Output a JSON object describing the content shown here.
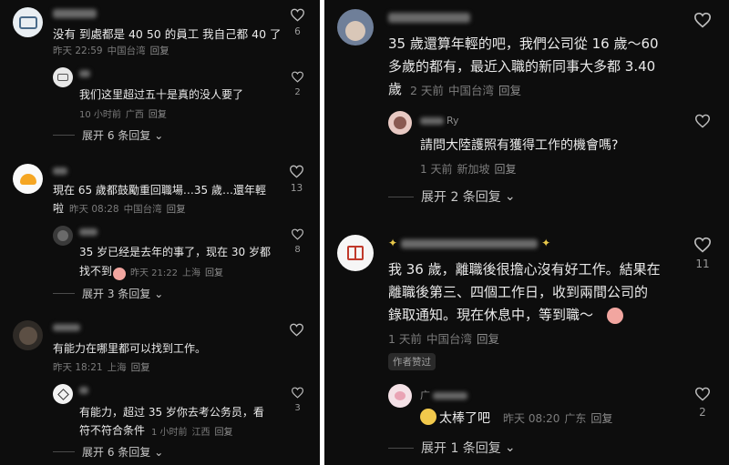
{
  "left": {
    "comments": [
      {
        "id": "c1",
        "text_lines": [
          "没有 到處都是 40 50 的員工 我自己都 40 了"
        ],
        "meta": {
          "time": "昨天 22:59",
          "location": "中国台湾",
          "reply": "回复"
        },
        "likes": "6",
        "reply": {
          "text_lines": [
            "我们这里超过五十是真的没人要了"
          ],
          "meta": {
            "time": "10 小时前",
            "location": "广西",
            "reply": "回复"
          },
          "likes": "2"
        },
        "expand": "展开 6 条回复"
      },
      {
        "id": "c2",
        "text_lines": [
          "現在 65 歲都鼓勵重回職場…35 歲…還年輕",
          "啦"
        ],
        "meta": {
          "time": "昨天 08:28",
          "location": "中国台湾",
          "reply": "回复"
        },
        "likes": "13",
        "reply": {
          "text_lines": [
            "35 岁已经是去年的事了，现在 30 岁都",
            "找不到"
          ],
          "meta": {
            "time": "昨天 21:22",
            "location": "上海",
            "reply": "回复"
          },
          "likes": "8"
        },
        "expand": "展开 3 条回复"
      },
      {
        "id": "c3",
        "text_lines": [
          "有能力在哪里都可以找到工作。"
        ],
        "meta": {
          "time": "昨天 18:21",
          "location": "上海",
          "reply": "回复"
        },
        "likes": "",
        "reply": {
          "text_lines": [
            "有能力，超过 35 岁你去考公务员，看",
            "符不符合条件"
          ],
          "meta": {
            "time": "1 小时前",
            "location": "江西",
            "reply": "回复"
          },
          "likes": "3"
        },
        "expand": "展开 6 条回复"
      }
    ]
  },
  "right": {
    "comments": [
      {
        "id": "r1",
        "text_lines": [
          "35 歲還算年輕的吧，我們公司從 16 歲～60",
          "多歲的都有，最近入職的新同事大多都 3.40",
          "歲"
        ],
        "meta": {
          "time": "2 天前",
          "location": "中国台湾",
          "reply": "回复"
        },
        "likes": "",
        "reply": {
          "username_fragment": "Ry",
          "text_lines": [
            "請問大陸護照有獲得工作的機會嗎?"
          ],
          "meta": {
            "time": "1 天前",
            "location": "新加坡",
            "reply": "回复"
          },
          "likes": ""
        },
        "expand": "展开 2 条回复"
      },
      {
        "id": "r2",
        "text_lines": [
          "我 36 歲，離職後很擔心沒有好工作。結果在",
          "離職後第三、四個工作日，收到兩間公司的",
          "錄取通知。現在休息中，等到職～"
        ],
        "meta": {
          "time": "1 天前",
          "location": "中国台湾",
          "reply": "回复"
        },
        "likes": "11",
        "badge": "作者赞过",
        "reply": {
          "username_fragment": "广",
          "text_lines": [
            "太棒了吧"
          ],
          "meta": {
            "time": "昨天 08:20",
            "location": "广东",
            "reply": "回复"
          },
          "likes": "2"
        },
        "expand": "展开 1 条回复"
      }
    ]
  },
  "colors": {
    "background": "#0d0d0d",
    "text": "#eaeaea",
    "meta": "#7c7c7c",
    "divider": "#ffffff"
  },
  "icons": {
    "like": "heart-outline-icon",
    "expand": "chevron-down-icon"
  }
}
